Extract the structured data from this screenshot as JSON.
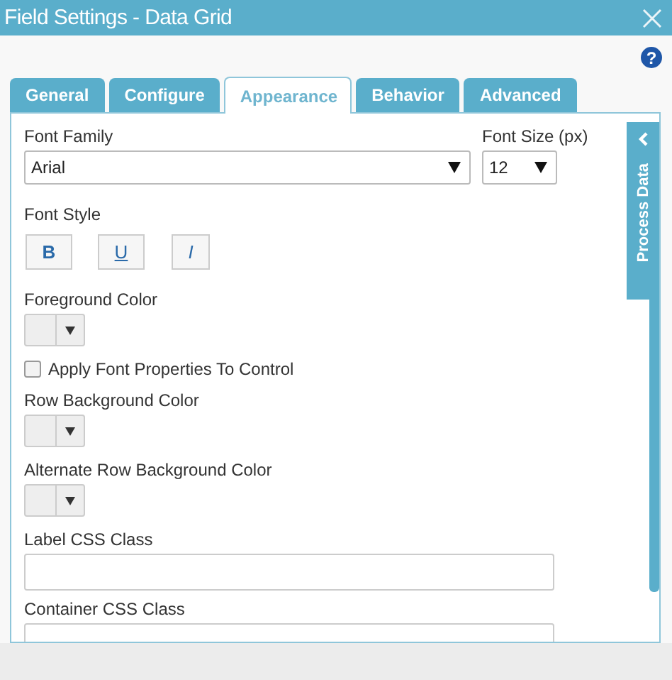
{
  "window": {
    "title": "Field Settings - Data Grid"
  },
  "help_button": "?",
  "tabs": [
    {
      "label": "General",
      "selected": false
    },
    {
      "label": "Configure",
      "selected": false
    },
    {
      "label": "Appearance",
      "selected": true
    },
    {
      "label": "Behavior",
      "selected": false
    },
    {
      "label": "Advanced",
      "selected": false
    }
  ],
  "side_panel": {
    "label": "Process Data"
  },
  "font_family": {
    "label": "Font Family",
    "value": "Arial"
  },
  "font_size": {
    "label": "Font Size (px)",
    "value": "12"
  },
  "font_style": {
    "label": "Font Style",
    "buttons": [
      {
        "label": "B",
        "kind": "bold"
      },
      {
        "label": "U",
        "kind": "underline"
      },
      {
        "label": "I",
        "kind": "italic"
      }
    ]
  },
  "settings": [
    {
      "kind": "color",
      "label": "Foreground Color"
    },
    {
      "kind": "checkbox",
      "label": "Apply Font Properties To Control",
      "checked": false
    },
    {
      "kind": "color",
      "label": "Row Background Color"
    },
    {
      "kind": "color",
      "label": "Alternate Row Background Color"
    },
    {
      "kind": "text",
      "label": "Label CSS Class"
    },
    {
      "kind": "text",
      "label": "Container CSS Class"
    }
  ]
}
